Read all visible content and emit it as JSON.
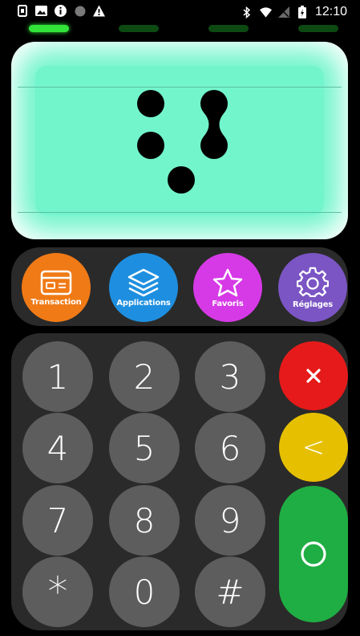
{
  "status_bar": {
    "time": "12:10"
  },
  "leds": [
    true,
    false,
    false,
    false
  ],
  "apps": [
    {
      "label": "Transaction",
      "icon": "card-icon",
      "color": "#f07a16"
    },
    {
      "label": "Applications",
      "icon": "layers-icon",
      "color": "#1e8fe0"
    },
    {
      "label": "Favoris",
      "icon": "star-icon",
      "color": "#d63ae6"
    },
    {
      "label": "Réglages",
      "icon": "gear-icon",
      "color": "#7b55c4"
    }
  ],
  "keys": [
    "1",
    "2",
    "3",
    "4",
    "5",
    "6",
    "7",
    "8",
    "9",
    "*",
    "0",
    "#"
  ],
  "function_keys": {
    "cancel": {
      "icon": "cancel-icon",
      "color": "#e61a1a"
    },
    "backspace": {
      "label": "<",
      "icon": "backspace-icon",
      "color": "#e6c000"
    },
    "confirm": {
      "icon": "circle-icon",
      "color": "#1fae43"
    }
  },
  "colors": {
    "screen": "#73f5cc",
    "panel": "#2a2a2a",
    "key": "#5d5d5d"
  }
}
